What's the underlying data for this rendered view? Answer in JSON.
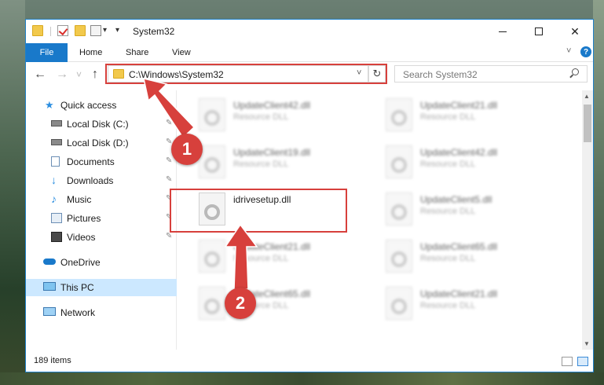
{
  "window": {
    "title": "System32",
    "accent": "#1979ca",
    "highlight": "#d7403c"
  },
  "ribbon": {
    "tabs": [
      "File",
      "Home",
      "Share",
      "View"
    ],
    "help_label": "?"
  },
  "navigation": {
    "back_arrow": "←",
    "forward_arrow": "→",
    "recent_chevron": "˅",
    "up_arrow": "↑",
    "address": "C:\\Windows\\System32",
    "refresh_glyph": "↻",
    "address_chevron": "˅",
    "search_placeholder": "Search System32"
  },
  "sidebar": {
    "items": [
      {
        "label": "Quick access",
        "icon": "star-icon"
      },
      {
        "label": "Local Disk (C:)",
        "icon": "drive-icon"
      },
      {
        "label": "Local Disk (D:)",
        "icon": "drive-icon"
      },
      {
        "label": "Documents",
        "icon": "document-icon"
      },
      {
        "label": "Downloads",
        "icon": "download-icon"
      },
      {
        "label": "Music",
        "icon": "music-icon"
      },
      {
        "label": "Pictures",
        "icon": "pictures-icon"
      },
      {
        "label": "Videos",
        "icon": "videos-icon"
      },
      {
        "label": "OneDrive",
        "icon": "cloud-icon"
      },
      {
        "label": "This PC",
        "icon": "monitor-icon"
      },
      {
        "label": "Network",
        "icon": "network-icon"
      }
    ],
    "pin_glyph": "📌"
  },
  "files": {
    "left_column": [
      {
        "name": "UpdateClient42.dll",
        "type": "Resource DLL"
      },
      {
        "name": "UpdateClient19.dll",
        "type": "Resource DLL"
      },
      {
        "name": "idrivesetup.dll",
        "type": ""
      },
      {
        "name": "UpdateClient21.dll",
        "type": "Resource DLL"
      },
      {
        "name": "UpdateClient65.dll",
        "type": "Resource DLL"
      }
    ],
    "right_column": [
      {
        "name": "UpdateClient21.dll",
        "type": "Resource DLL"
      },
      {
        "name": "UpdateClient42.dll",
        "type": "Resource DLL"
      },
      {
        "name": "UpdateClient5.dll",
        "type": "Resource DLL"
      },
      {
        "name": "UpdateClient65.dll",
        "type": "Resource DLL"
      },
      {
        "name": "UpdateClient21.dll",
        "type": "Resource DLL"
      }
    ]
  },
  "status": {
    "item_count": "189 items"
  },
  "callouts": {
    "step1": "1",
    "step2": "2"
  }
}
